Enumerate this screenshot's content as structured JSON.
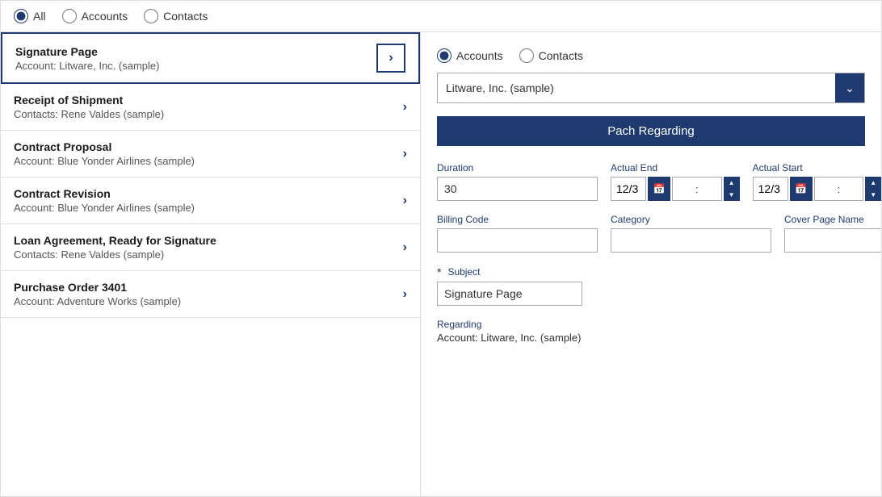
{
  "topBar": {
    "radioOptions": [
      {
        "id": "all",
        "label": "All",
        "checked": true
      },
      {
        "id": "accounts",
        "label": "Accounts",
        "checked": false
      },
      {
        "id": "contacts",
        "label": "Contacts",
        "checked": false
      }
    ]
  },
  "listItems": [
    {
      "title": "Signature Page",
      "subtitle": "Account: Litware, Inc. (sample)",
      "selected": true
    },
    {
      "title": "Receipt of Shipment",
      "subtitle": "Contacts: Rene Valdes (sample)",
      "selected": false
    },
    {
      "title": "Contract Proposal",
      "subtitle": "Account: Blue Yonder Airlines (sample)",
      "selected": false
    },
    {
      "title": "Contract Revision",
      "subtitle": "Account: Blue Yonder Airlines (sample)",
      "selected": false
    },
    {
      "title": "Loan Agreement, Ready for Signature",
      "subtitle": "Contacts: Rene Valdes (sample)",
      "selected": false
    },
    {
      "title": "Purchase Order 3401",
      "subtitle": "Account: Adventure Works (sample)",
      "selected": false
    }
  ],
  "rightPanel": {
    "radioOptions": [
      {
        "id": "accounts-right",
        "label": "Accounts",
        "checked": true
      },
      {
        "id": "contacts-right",
        "label": "Contacts",
        "checked": false
      }
    ],
    "dropdownValue": "Litware, Inc. (sample)",
    "patchButtonLabel": "Pach Regarding",
    "fields": {
      "duration": {
        "label": "Duration",
        "value": "30"
      },
      "actualEnd": {
        "label": "Actual End",
        "date": "12/3",
        "time1": "",
        "time2": ""
      },
      "actualStart": {
        "label": "Actual Start",
        "date": "12/3",
        "time1": "",
        "time2": ""
      },
      "billingCode": {
        "label": "Billing Code",
        "value": ""
      },
      "category": {
        "label": "Category",
        "value": ""
      },
      "coverPageName": {
        "label": "Cover Page Name",
        "value": ""
      }
    },
    "subject": {
      "label": "Subject",
      "required": true,
      "value": "Signature Page"
    },
    "regarding": {
      "label": "Regarding",
      "value": "Account: Litware, Inc. (sample)"
    }
  }
}
